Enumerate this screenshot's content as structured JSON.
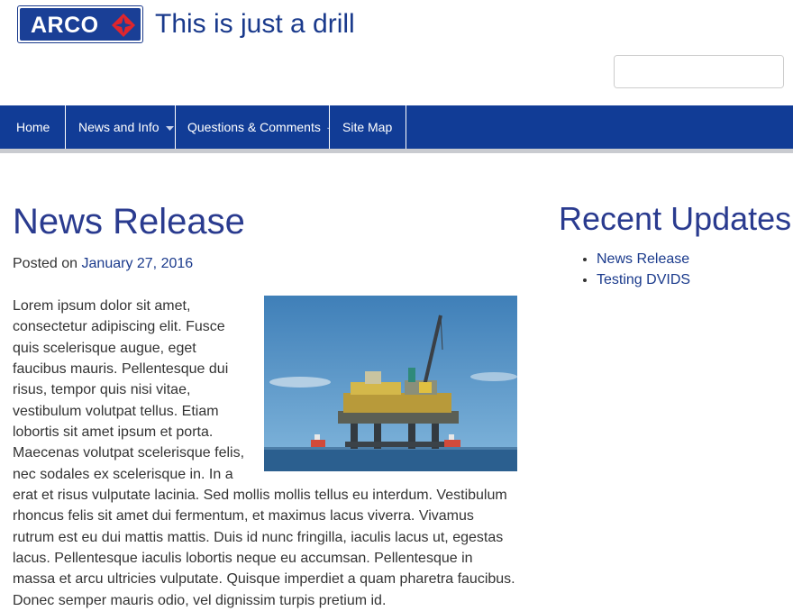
{
  "header": {
    "logo_text": "ARCO",
    "site_title": "This is just a drill"
  },
  "search": {
    "placeholder": "",
    "value": ""
  },
  "nav": {
    "items": [
      {
        "label": "Home"
      },
      {
        "label": "News and Info"
      },
      {
        "label": "Questions & Comments"
      },
      {
        "label": "Site Map"
      }
    ]
  },
  "post": {
    "title": "News Release",
    "posted_prefix": "Posted on",
    "date": "January 27, 2016",
    "body": "Lorem ipsum dolor sit amet, consectetur adipiscing elit. Fusce quis scelerisque augue, eget faucibus mauris. Pellentesque dui risus, tempor quis nisi vitae, vestibulum volutpat tellus. Etiam lobortis sit amet ipsum et porta. Maecenas volutpat scelerisque felis, nec sodales ex scelerisque in. In a erat et risus vulputate lacinia. Sed mollis mollis tellus eu interdum. Vestibulum rhoncus felis sit amet dui fermentum, et maximus lacus viverra. Vivamus rutrum est eu dui mattis mattis. Duis id nunc fringilla, iaculis lacus ut, egestas lacus. Pellentesque iaculis lobortis neque eu accumsan. Pellentesque in massa et arcu ultricies vulputate. Quisque imperdiet a quam pharetra faucibus. Donec semper mauris odio, vel dignissim turpis pretium id."
  },
  "sidebar": {
    "title": "Recent Updates",
    "links": [
      {
        "label": "News Release"
      },
      {
        "label": "Testing DVIDS"
      }
    ]
  },
  "colors": {
    "brand": "#113c96",
    "heading": "#2a3b8f",
    "link": "#1a3a8c",
    "nav_underline": "#c9cbd0"
  },
  "icons": {
    "logo_mark": "arco-diamond-icon",
    "search": "search-icon",
    "dropdown": "caret-down-icon"
  }
}
